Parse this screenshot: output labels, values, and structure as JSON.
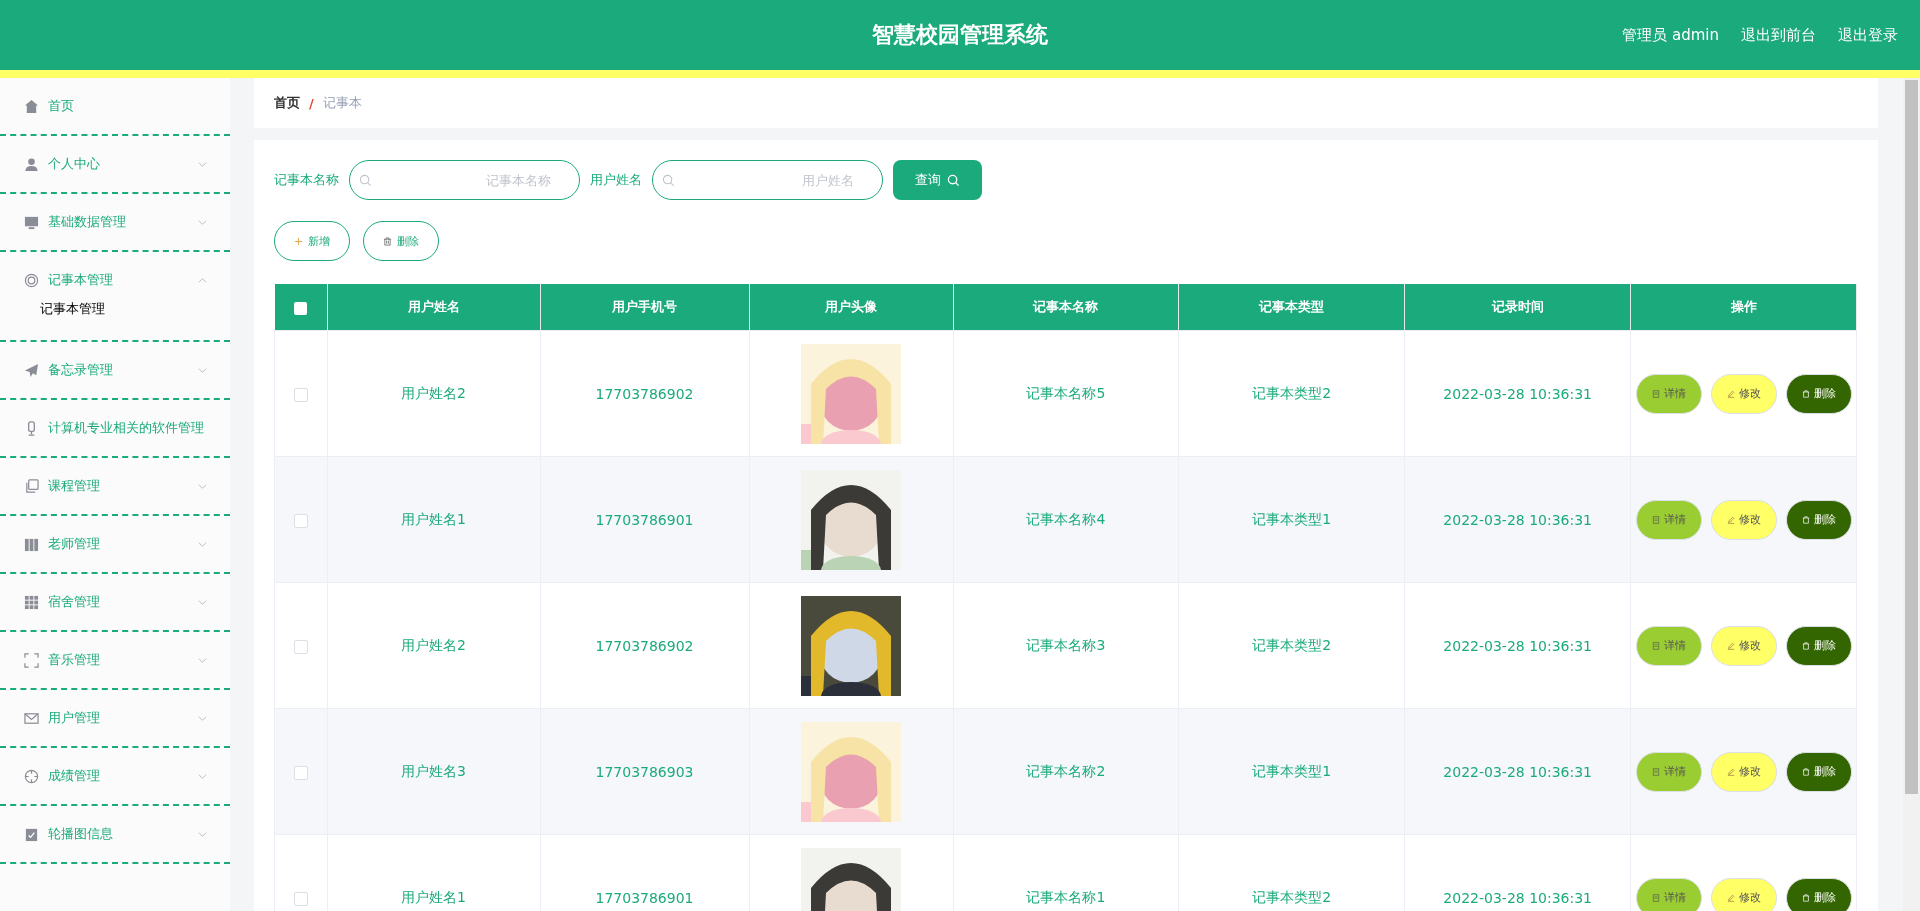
{
  "header": {
    "title": "智慧校园管理系统",
    "user": "管理员 admin",
    "links": [
      "退出到前台",
      "退出登录"
    ]
  },
  "sidebar": {
    "items": [
      {
        "label": "首页"
      },
      {
        "label": "个人中心",
        "expanded": false
      },
      {
        "label": "基础数据管理",
        "expanded": false
      },
      {
        "label": "记事本管理",
        "expanded": true,
        "children": [
          {
            "label": "记事本管理"
          }
        ]
      },
      {
        "label": "备忘录管理",
        "expanded": false
      },
      {
        "label": "计算机专业相关的软件管理"
      },
      {
        "label": "课程管理",
        "expanded": false
      },
      {
        "label": "老师管理",
        "expanded": false
      },
      {
        "label": "宿舍管理",
        "expanded": false
      },
      {
        "label": "音乐管理",
        "expanded": false
      },
      {
        "label": "用户管理",
        "expanded": false
      },
      {
        "label": "成绩管理",
        "expanded": false
      },
      {
        "label": "轮播图信息",
        "expanded": false
      }
    ]
  },
  "breadcrumb": {
    "items": [
      "首页",
      "记事本"
    ],
    "separator": "/"
  },
  "search": {
    "fields": [
      {
        "label": "记事本名称",
        "placeholder": "记事本名称"
      },
      {
        "label": "用户姓名",
        "placeholder": "用户姓名"
      }
    ],
    "button": "查询"
  },
  "toolbar": [
    {
      "kind": "add",
      "label": "新增"
    },
    {
      "kind": "delete",
      "label": "删除"
    }
  ],
  "table": {
    "all_selected": false,
    "columns": [
      "用户姓名",
      "用户手机号",
      "用户头像",
      "记事本名称",
      "记事本类型",
      "记录时间",
      "操作"
    ],
    "rows": [
      {
        "selected": false,
        "name": "用户姓名2",
        "phone": "17703786902",
        "notebook": "记事本名称5",
        "type": "记事本类型2",
        "time": "2022-03-28 10:36:31",
        "actions": [
          {
            "kind": "detail",
            "label": "详情"
          },
          {
            "kind": "edit",
            "label": "修改"
          },
          {
            "kind": "delete",
            "label": "删除"
          }
        ]
      },
      {
        "selected": false,
        "name": "用户姓名1",
        "phone": "17703786901",
        "notebook": "记事本名称4",
        "type": "记事本类型1",
        "time": "2022-03-28 10:36:31",
        "actions": [
          {
            "kind": "detail",
            "label": "详情"
          },
          {
            "kind": "edit",
            "label": "修改"
          },
          {
            "kind": "delete",
            "label": "删除"
          }
        ]
      },
      {
        "selected": false,
        "name": "用户姓名2",
        "phone": "17703786902",
        "notebook": "记事本名称3",
        "type": "记事本类型2",
        "time": "2022-03-28 10:36:31",
        "actions": [
          {
            "kind": "detail",
            "label": "详情"
          },
          {
            "kind": "edit",
            "label": "修改"
          },
          {
            "kind": "delete",
            "label": "删除"
          }
        ]
      },
      {
        "selected": false,
        "name": "用户姓名3",
        "phone": "17703786903",
        "notebook": "记事本名称2",
        "type": "记事本类型1",
        "time": "2022-03-28 10:36:31",
        "actions": [
          {
            "kind": "detail",
            "label": "详情"
          },
          {
            "kind": "edit",
            "label": "修改"
          },
          {
            "kind": "delete",
            "label": "删除"
          }
        ]
      },
      {
        "selected": false,
        "name": "用户姓名1",
        "phone": "17703786901",
        "notebook": "记事本名称1",
        "type": "记事本类型2",
        "time": "2022-03-28 10:36:31",
        "actions": [
          {
            "kind": "detail",
            "label": "详情"
          },
          {
            "kind": "edit",
            "label": "修改"
          },
          {
            "kind": "delete",
            "label": "删除"
          }
        ]
      }
    ]
  }
}
